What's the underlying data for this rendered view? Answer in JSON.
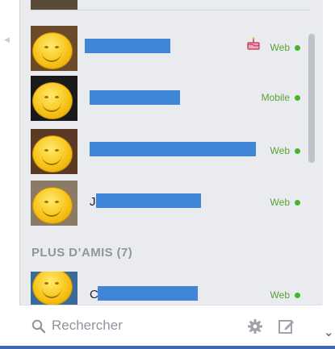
{
  "chat_sidebar": {
    "contacts": [
      {
        "status": "Web",
        "has_birthday_icon": true,
        "avatar_bg": "#6b4a2a"
      },
      {
        "status": "Mobile",
        "has_birthday_icon": false,
        "avatar_bg": "#1a1a1a"
      },
      {
        "status": "Web",
        "has_birthday_icon": false,
        "avatar_bg": "#5b3a25"
      },
      {
        "status": "Web",
        "has_birthday_icon": false,
        "avatar_bg": "#8a7a68",
        "name_initial": "J"
      }
    ],
    "more_friends": {
      "title": "PLUS D’AMIS (7)",
      "contacts": [
        {
          "status": "Web",
          "avatar_bg": "#3a6a9a",
          "name_initial": "C"
        }
      ]
    }
  },
  "search": {
    "placeholder": "Rechercher"
  },
  "icons": {
    "search": "search-icon",
    "gear": "gear-icon",
    "compose": "compose-icon",
    "birthday": "birthday-cake-icon",
    "chevron": "chevron-down-icon"
  },
  "colors": {
    "online_dot": "#42b72a",
    "status_text": "#59a13b",
    "name_redaction": "#3f86d8",
    "panel_bg": "#e9ebee"
  }
}
